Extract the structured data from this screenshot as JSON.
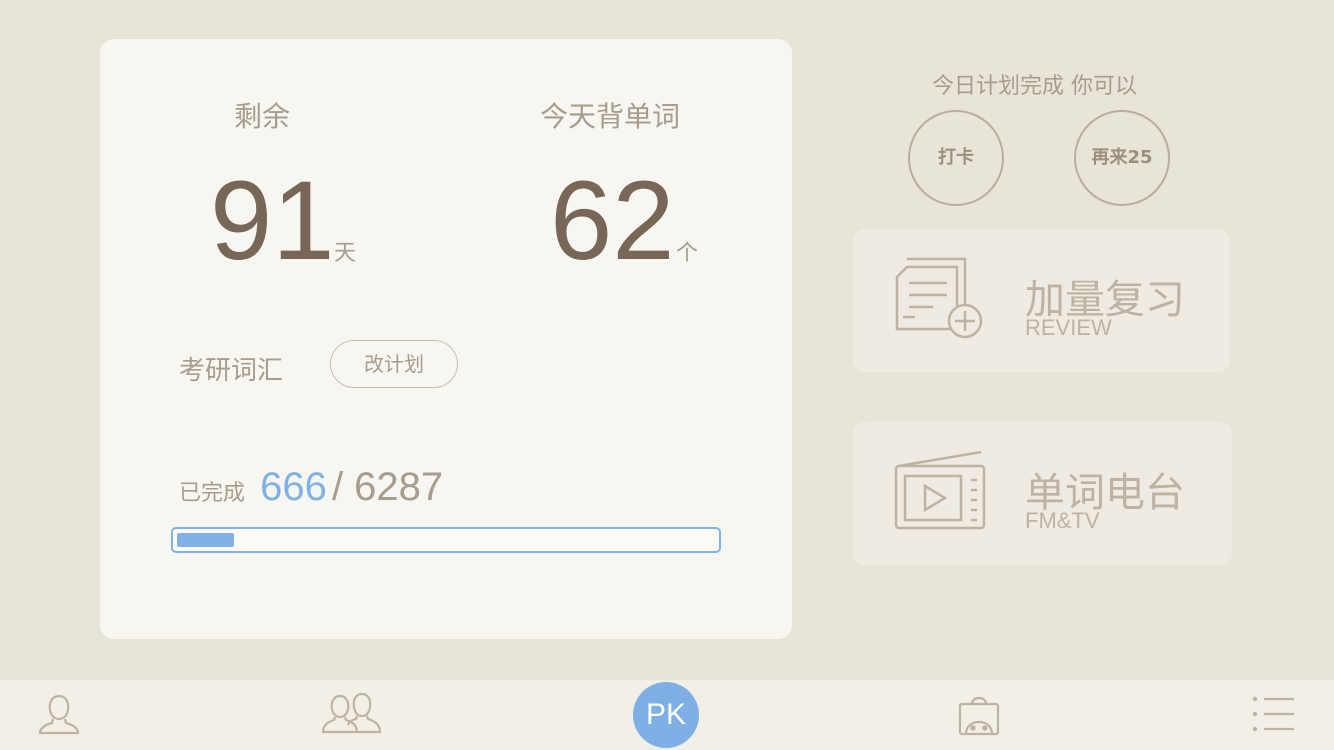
{
  "main_card": {
    "remaining_label": "剩余",
    "remaining_days": "91",
    "days_unit": "天",
    "today_label": "今天背单词",
    "today_words": "62",
    "words_unit": "个",
    "plan_name": "考研词汇",
    "change_plan_label": "改计划",
    "completed_label": "已完成",
    "completed_count": "666",
    "total_separator": "/ 6287",
    "progress_fraction": 0.106
  },
  "right_panel": {
    "title": "今日计划完成 你可以",
    "checkin_label": "打卡",
    "again_label": "再来25",
    "review": {
      "title": "加量复习",
      "subtitle": "REVIEW",
      "icon": "document-add-icon"
    },
    "radio": {
      "title": "单词电台",
      "subtitle": "FM&TV",
      "icon": "radio-icon"
    }
  },
  "bottom_nav": {
    "pk_label": "PK",
    "items": [
      "user-icon",
      "friends-icon",
      "shop-bag-icon",
      "menu-list-icon"
    ]
  },
  "colors": {
    "background": "#e8e4d8",
    "card": "#f8f6f0",
    "accent_blue": "#7eb2e6",
    "text_brown": "#786656",
    "text_muted": "#a89c8c"
  }
}
